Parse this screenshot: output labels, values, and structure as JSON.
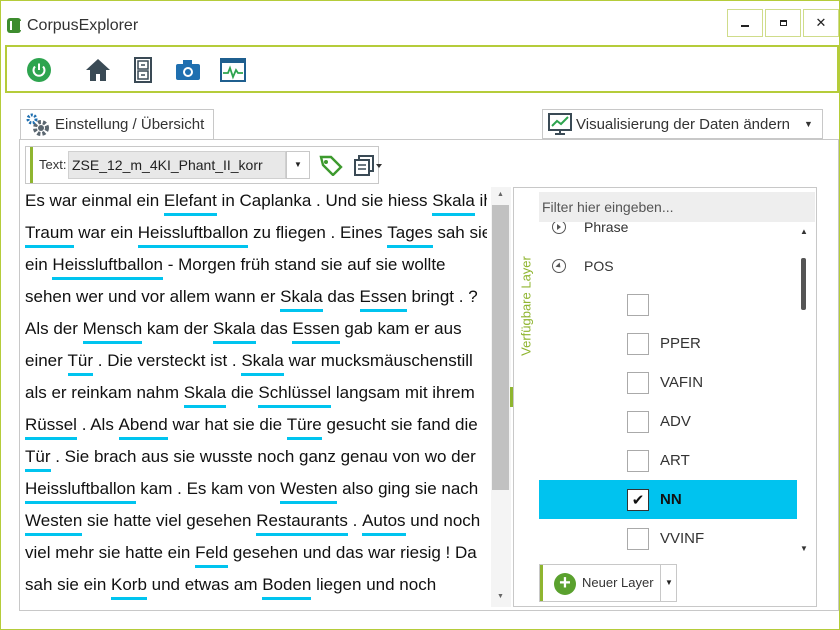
{
  "window": {
    "title": "CorpusExplorer",
    "controls": {
      "minimize": "minimize",
      "maximize": "maximize",
      "close": "✕"
    }
  },
  "toolbar": {
    "icons": [
      "power-icon",
      "home-icon",
      "cabinet-icon",
      "camera-icon",
      "monitor-icon"
    ],
    "accent_color": "#b5cc3a"
  },
  "tabs": {
    "settings_label": "Einstellung / Übersicht",
    "visualize_label": "Visualisierung der Daten ändern"
  },
  "textbar": {
    "label": "Text:",
    "selected_text": "ZSE_12_m_4KI_Phant_II_korr"
  },
  "document": {
    "highlight_color": "#00c4ef",
    "lines": [
      [
        [
          "Es war einmal ein ",
          false
        ],
        [
          "Elefant",
          true
        ],
        [
          " in Caplanka . Und sie hiess ",
          false
        ],
        [
          "Skala",
          true
        ],
        [
          " ihr",
          false
        ]
      ],
      [
        [
          "Traum",
          true
        ],
        [
          " war ein ",
          false
        ],
        [
          "Heissluftballon",
          true
        ],
        [
          " zu fliegen . Eines ",
          false
        ],
        [
          "Tages",
          true
        ],
        [
          " sah sie",
          false
        ]
      ],
      [
        [
          "ein ",
          false
        ],
        [
          "Heissluftballon",
          true
        ],
        [
          " - Morgen früh stand sie auf sie wollte",
          false
        ]
      ],
      [
        [
          "sehen wer und vor allem wann er ",
          false
        ],
        [
          "Skala",
          true
        ],
        [
          " das ",
          false
        ],
        [
          "Essen",
          true
        ],
        [
          " bringt . ?",
          false
        ]
      ],
      [
        [
          "Als der ",
          false
        ],
        [
          "Mensch",
          true
        ],
        [
          " kam der ",
          false
        ],
        [
          "Skala",
          true
        ],
        [
          " das ",
          false
        ],
        [
          "Essen",
          true
        ],
        [
          " gab kam er aus",
          false
        ]
      ],
      [
        [
          "einer ",
          false
        ],
        [
          "Tür",
          true
        ],
        [
          " . Die versteckt ist . ",
          false
        ],
        [
          "Skala",
          true
        ],
        [
          " war mucksmäuschenstill",
          false
        ]
      ],
      [
        [
          "als er reinkam nahm ",
          false
        ],
        [
          "Skala",
          true
        ],
        [
          " die ",
          false
        ],
        [
          "Schlüssel",
          true
        ],
        [
          " langsam mit ihrem",
          false
        ]
      ],
      [
        [
          "Rüssel",
          true
        ],
        [
          " . Als ",
          false
        ],
        [
          "Abend",
          true
        ],
        [
          " war hat sie die ",
          false
        ],
        [
          "Türe",
          true
        ],
        [
          " gesucht sie fand die",
          false
        ]
      ],
      [
        [
          "Tür",
          true
        ],
        [
          " . Sie brach aus sie wusste noch ganz genau von wo der",
          false
        ]
      ],
      [
        [
          "Heissluftballon",
          true
        ],
        [
          " kam . Es kam von ",
          false
        ],
        [
          "Westen",
          true
        ],
        [
          " also ging sie nach",
          false
        ]
      ],
      [
        [
          "Westen",
          true
        ],
        [
          " sie hatte viel gesehen ",
          false
        ],
        [
          "Restaurants",
          true
        ],
        [
          " . ",
          false
        ],
        [
          "Autos",
          true
        ],
        [
          " und noch",
          false
        ]
      ],
      [
        [
          "viel mehr sie hatte ein ",
          false
        ],
        [
          "Feld",
          true
        ],
        [
          " gesehen und das war riesig ! Da",
          false
        ]
      ],
      [
        [
          "sah sie ein ",
          false
        ],
        [
          "Korb",
          true
        ],
        [
          " und etwas am ",
          false
        ],
        [
          "Boden",
          true
        ],
        [
          " liegen und noch",
          false
        ]
      ]
    ]
  },
  "layers": {
    "panel_title": "Verfügbare Layer",
    "filter_placeholder": "Filter hier eingeben...",
    "nodes": [
      {
        "label": "Phrase",
        "expanded": false
      },
      {
        "label": "POS",
        "expanded": true
      }
    ],
    "pos_items": [
      {
        "label": "",
        "checked": false,
        "selected": false
      },
      {
        "label": "PPER",
        "checked": false,
        "selected": false
      },
      {
        "label": "VAFIN",
        "checked": false,
        "selected": false
      },
      {
        "label": "ADV",
        "checked": false,
        "selected": false
      },
      {
        "label": "ART",
        "checked": false,
        "selected": false
      },
      {
        "label": "NN",
        "checked": true,
        "selected": true
      },
      {
        "label": "VVINF",
        "checked": false,
        "selected": false
      }
    ],
    "selection_color": "#00c3ef",
    "new_layer_label": "Neuer Layer"
  }
}
